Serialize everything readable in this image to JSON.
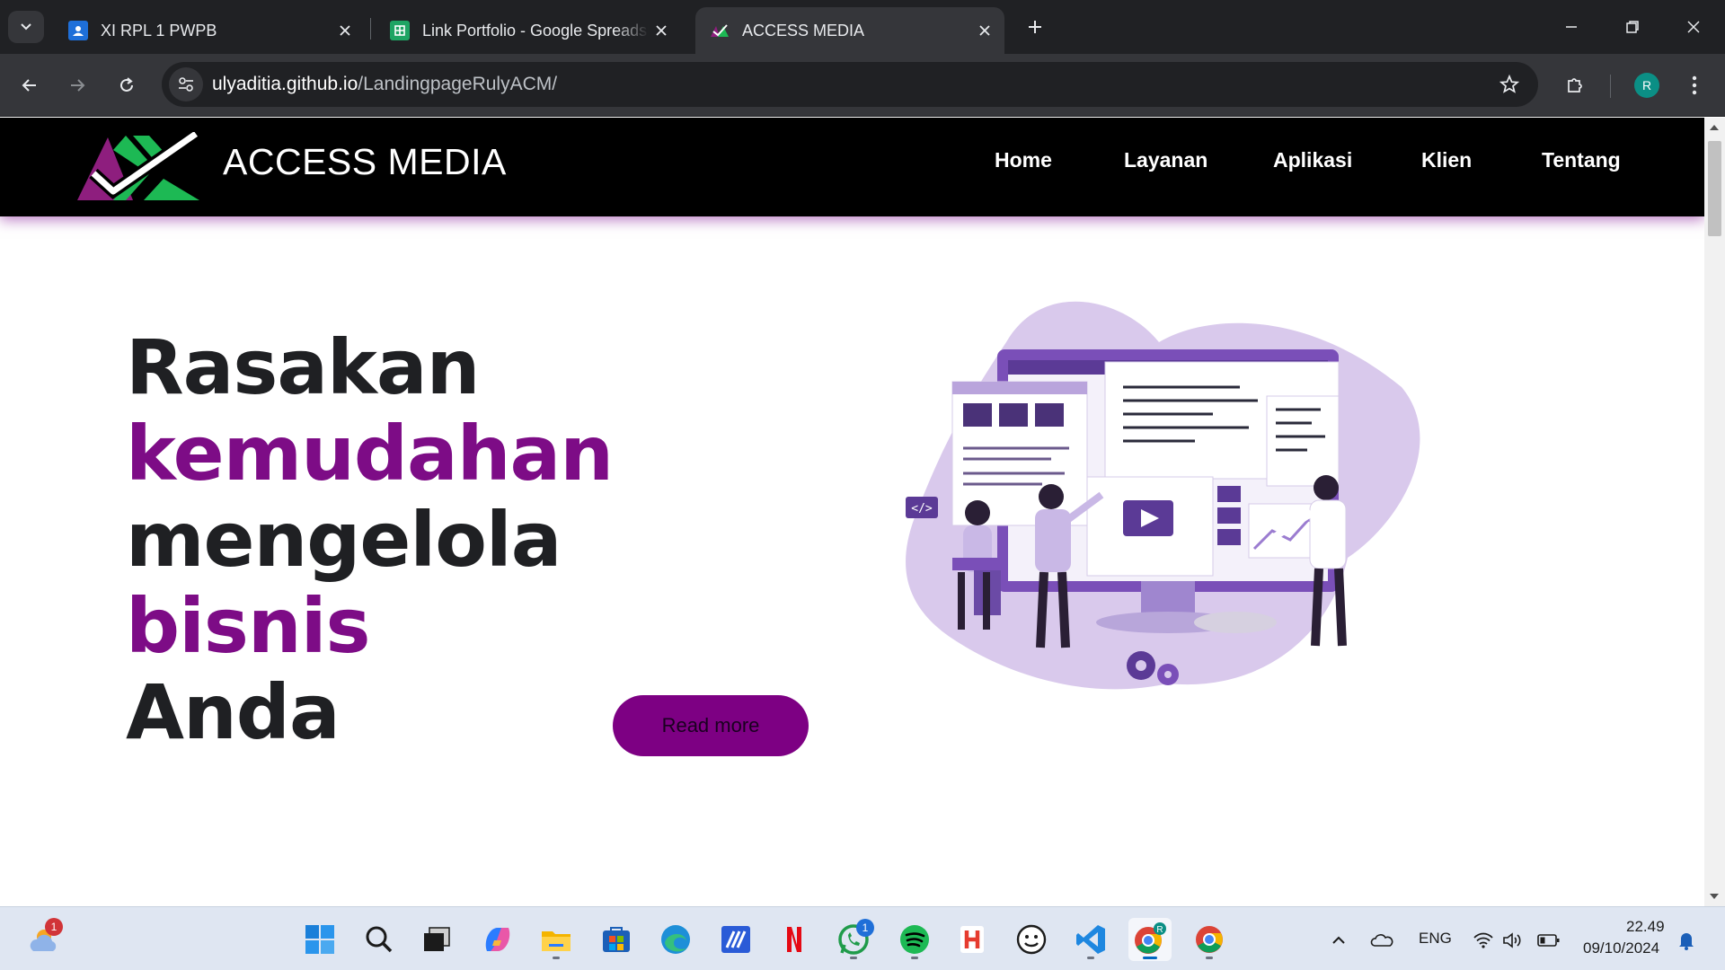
{
  "browser": {
    "tabs": [
      {
        "title": "XI RPL 1 PWPB",
        "icon": "google-classroom-icon",
        "active": false
      },
      {
        "title": "Link Portfolio - Google Spreadsheets",
        "icon": "google-sheets-icon",
        "active": false
      },
      {
        "title": "ACCESS MEDIA",
        "icon": "access-media-favicon",
        "active": true
      }
    ],
    "url": {
      "host": "ulyaditia.github.io",
      "path": "/LandingpageRulyACM/"
    },
    "profile_initial": "R"
  },
  "site": {
    "brand": "ACCESS MEDIA",
    "nav": [
      "Home",
      "Layanan",
      "Aplikasi",
      "Klien",
      "Tentang"
    ],
    "hero": {
      "line1": "Rasakan",
      "line2_accent": "kemudahan",
      "line3_plain": "mengelola",
      "line3_accent": "bisnis",
      "line4": "Anda",
      "button": "Read more"
    },
    "colors": {
      "accent": "#7d0c86",
      "nav_bg": "#000000",
      "logo_green": "#1db954",
      "logo_purple": "#8e1e7e"
    }
  },
  "illustration": {
    "code_tag": "</>"
  },
  "taskbar": {
    "apps": [
      {
        "name": "windows-start-icon"
      },
      {
        "name": "search-icon"
      },
      {
        "name": "task-view-icon"
      },
      {
        "name": "copilot-icon"
      },
      {
        "name": "file-explorer-icon",
        "running": true
      },
      {
        "name": "microsoft-store-icon"
      },
      {
        "name": "edge-icon"
      },
      {
        "name": "code-editor-icon"
      },
      {
        "name": "netflix-icon"
      },
      {
        "name": "whatsapp-icon",
        "badge": "1",
        "running": true
      },
      {
        "name": "spotify-icon",
        "running": true
      },
      {
        "name": "hackerrank-icon"
      },
      {
        "name": "emoji-app-icon"
      },
      {
        "name": "vscode-icon",
        "running": true
      },
      {
        "name": "chrome-profile-icon",
        "running": true,
        "active": true
      },
      {
        "name": "chrome-icon",
        "running": true
      }
    ],
    "weather_badge": "1",
    "language": "ENG",
    "time": "22.49",
    "date": "09/10/2024"
  }
}
